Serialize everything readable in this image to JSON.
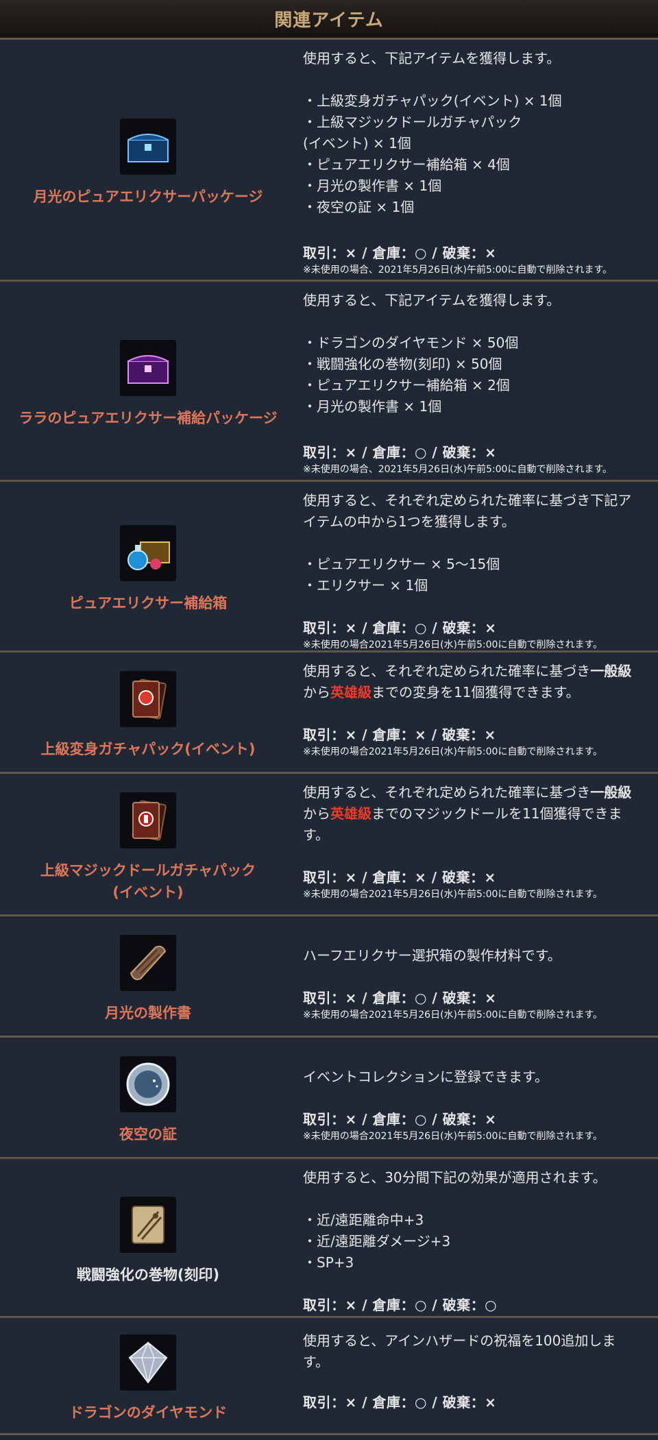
{
  "header": {
    "title": "関連アイテム"
  },
  "items": [
    {
      "name": "月光のピュアエリクサーパッケージ",
      "icon": "blue-chest-icon",
      "desc": "使用すると、下記アイテムを獲得します。",
      "list": [
        "・上級変身ガチャパック(イベント) × 1個",
        "・上級マジックドールガチャパック",
        "(イベント) × 1個",
        "・ピュアエリクサー補給箱 × 4個",
        "・月光の製作書 × 1個",
        "・夜空の証 × 1個"
      ],
      "trade": "取引：× / 倉庫：○ / 破棄：×",
      "note": "※未使用の場合、2021年5月26日(水)午前5:00に自動で削除されます。"
    },
    {
      "name": "ララのピュアエリクサー補給パッケージ",
      "icon": "purple-chest-icon",
      "desc": "使用すると、下記アイテムを獲得します。",
      "list": [
        "・ドラゴンのダイヤモンド × 50個",
        "・戦闘強化の巻物(刻印) × 50個",
        "・ピュアエリクサー補給箱 × 2個",
        "・月光の製作書 × 1個"
      ],
      "trade": "取引：× / 倉庫：○ / 破棄：×",
      "note": "※未使用の場合、2021年5月26日(水)午前5:00に自動で削除されます。"
    },
    {
      "name": "ピュアエリクサー補給箱",
      "icon": "elixir-chest-icon",
      "desc1": "使用すると、それぞれ定められた確率に基づき下記ア",
      "desc2": "イテムの中から1つを獲得します。",
      "list": [
        "・ピュアエリクサー × 5〜15個",
        "・エリクサー × 1個"
      ],
      "trade": "取引：× / 倉庫：○ / 破棄：×",
      "note": "※未使用の場合2021年5月26日(水)午前5:00に自動で削除されます。"
    },
    {
      "name": "上級変身ガチャパック(イベント)",
      "icon": "polymorph-card-pack-icon",
      "desc_a": "使用すると、それぞれ定められた確率に基づき",
      "desc_b": "一般級",
      "desc_c": "から",
      "desc_d": "英雄級",
      "desc_e": "までの変身を11個獲得できます。",
      "trade": "取引：× / 倉庫：× / 破棄：×",
      "note": "※未使用の場合2021年5月26日(水)午前5:00に自動で削除されます。"
    },
    {
      "name": "上級マジックドールガチャパック",
      "name2": "(イベント)",
      "icon": "doll-card-pack-icon",
      "desc_a": "使用すると、それぞれ定められた確率に基づき",
      "desc_b": "一般級",
      "desc_c": "から",
      "desc_d": "英雄級",
      "desc_e": "までのマジックドールを11個獲得できま",
      "desc_f": "す。",
      "trade": "取引：× / 倉庫：× / 破棄：×",
      "note": "※未使用の場合2021年5月26日(水)午前5:00に自動で削除されます。"
    },
    {
      "name": "月光の製作書",
      "icon": "scroll-icon",
      "desc": "ハーフエリクサー選択箱の製作材料です。",
      "trade": "取引：× / 倉庫：○ / 破棄：×",
      "note": "※未使用の場合2021年5月26日(水)午前5:00に自動で削除されます。"
    },
    {
      "name": "夜空の証",
      "icon": "moon-medal-icon",
      "desc": "イベントコレクションに登録できます。",
      "trade": "取引：× / 倉庫：○ / 破棄：×",
      "note": "※未使用の場合2021年5月26日(水)午前5:00に自動で削除されます。"
    },
    {
      "name": "戦闘強化の巻物(刻印)",
      "icon": "battle-scroll-icon",
      "desc": "使用すると、30分間下記の効果が適用されます。",
      "list": [
        "・近/遠距離命中+3",
        "・近/遠距離ダメージ+3",
        "・SP+3"
      ],
      "trade": "取引：× / 倉庫：○ / 破棄：○"
    },
    {
      "name": "ドラゴンのダイヤモンド",
      "icon": "diamond-icon",
      "desc1": "使用すると、アインハザードの祝福を100追加しま",
      "desc2": "す。",
      "trade": "取引：× / 倉庫：○ / 破棄：×"
    }
  ],
  "colors": {
    "accent": "#e07659",
    "hero": "#f03a2a",
    "header_text": "#c9a978",
    "background": "#1f2834"
  }
}
